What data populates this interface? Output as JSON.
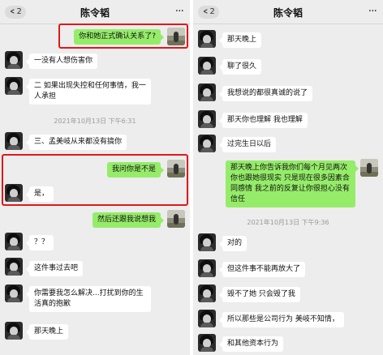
{
  "left": {
    "back_count": "2",
    "title": "陈令韬",
    "more": "···",
    "msg1": "你和她正式确认关系了?",
    "msg2": "一没有人想伤害你",
    "msg3": "二 如果出现失控和任何事情，我一人承担",
    "timestamp": "2021年10月13日 下午6:31",
    "msg4": "三、孟美岐从来都没有搞你",
    "msg5": "我问你是不是",
    "msg6": "是，",
    "msg7": "然后还跟我说想我",
    "msg8": "？？",
    "msg9": "这件事过去吧",
    "msg10": "你需要我怎么解决...打扰到你的生活真的抱歉",
    "msg11": "那天晚上"
  },
  "right": {
    "back_count": "2",
    "title": "陈令韬",
    "more": "···",
    "msg1": "那天晚上",
    "msg2": "聊了很久",
    "msg3": "我想说的都很真诚的说了",
    "msg4": "那天你也理解 我也理解",
    "msg5": "过完生日以后",
    "msg6": "那天晚上你告诉我你们每个月见两次 你也跟她很现实 只是现在很多因素合同感情 我之前的反复让你很担心没有信任",
    "timestamp": "2021年10月13日 下午9:36",
    "msg7": "对的",
    "msg8": "但这件事不能再放大了",
    "msg9": "毁不了她 只会毁了我",
    "msg10": "所以那些是公司行为 美岐不知情，",
    "msg11": "和其他资本行为"
  },
  "colors": {
    "chat_bg": "#ededed",
    "bubble_incoming": "#ffffff",
    "bubble_outgoing": "#95ec69",
    "highlight": "#e0181b"
  }
}
